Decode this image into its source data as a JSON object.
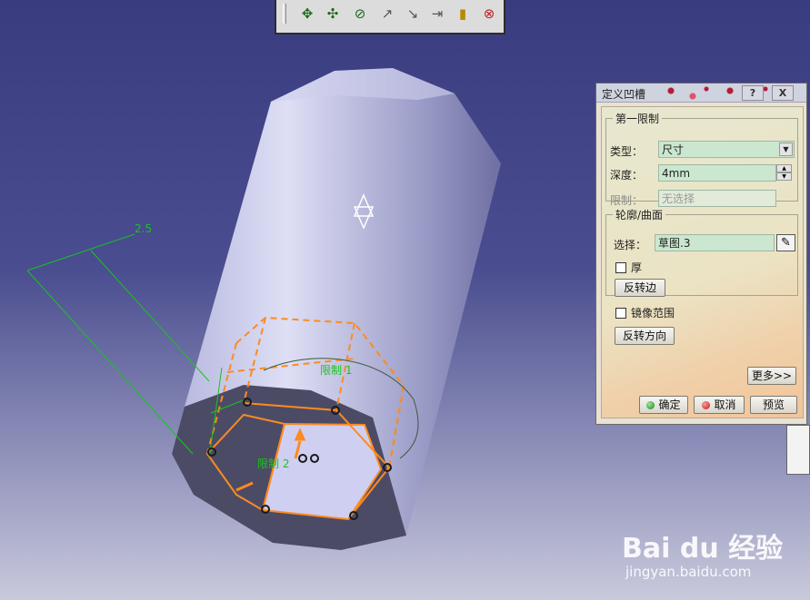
{
  "toolbar": {
    "buttons": [
      "move-icon",
      "rotate-icon",
      "snap-icon",
      "point-icon",
      "line-icon",
      "dimension-icon",
      "ruler-icon",
      "sketch-constraint-icon"
    ]
  },
  "canvas": {
    "dim_value": "2.5",
    "limit1": "限制 1",
    "limit2": "限制 2"
  },
  "dialog": {
    "title": "定义凹槽",
    "help_btn": "?",
    "close_btn": "X",
    "first_limit": {
      "legend": "第一限制",
      "type_label": "类型：",
      "type_value": "尺寸",
      "depth_label": "深度：",
      "depth_value": "4mm",
      "limit_label": "限制：",
      "limit_value": "无选择"
    },
    "profile": {
      "legend": "轮廓/曲面",
      "select_label": "选择：",
      "select_value": "草图.3",
      "thick_label": "厚",
      "reverse_side_btn": "反转边"
    },
    "mirror_label": "镜像范围",
    "reverse_dir_btn": "反转方向",
    "more_btn": "更多>>",
    "ok_btn": "确定",
    "cancel_btn": "取消",
    "preview_btn": "预览"
  },
  "watermark": {
    "brand": "Bai du 经验",
    "url": "jingyan.baidu.com"
  },
  "colors": {
    "accent_orange": "#ff8a1e",
    "dim_green": "#19c41e",
    "field_green": "#cbe7cf"
  }
}
